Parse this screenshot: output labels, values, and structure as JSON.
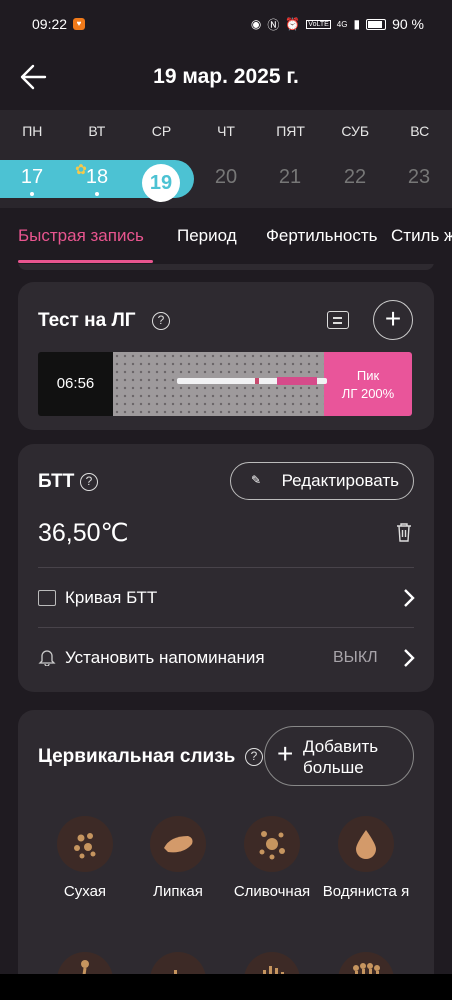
{
  "status_bar": {
    "time": "09:22",
    "battery": "90 %",
    "network": "4G",
    "volte": "VoLTE"
  },
  "header": {
    "title": "19 мар. 2025 г."
  },
  "calendar": {
    "weekdays": [
      "ПН",
      "ВТ",
      "СР",
      "ЧТ",
      "ПЯТ",
      "СУБ",
      "ВС"
    ],
    "dates": [
      "17",
      "18",
      "19",
      "20",
      "21",
      "22",
      "23"
    ],
    "today": "19"
  },
  "tabs": [
    "Быстрая запись",
    "Период",
    "Фертильность",
    "Стиль ж"
  ],
  "lh_test": {
    "title": "Тест на ЛГ",
    "time": "06:56",
    "result_line1": "Пик",
    "result_line2": "ЛГ 200%",
    "accent": "#e9559a"
  },
  "btt": {
    "title": "БТТ",
    "edit_label": "Редактировать",
    "value": "36,50℃",
    "curve_label": "Кривая БТТ",
    "reminder_label": "Установить напоминания",
    "reminder_state": "ВЫКЛ"
  },
  "cervical_mucus": {
    "title": "Цервикальная слизь",
    "add_more_line1": "Добавить",
    "add_more_line2": "больше",
    "options": [
      "Сухая",
      "Липкая",
      "Сливочная",
      "Водяниста я"
    ]
  },
  "colors": {
    "accent_pink": "#e9558f",
    "period_blue": "#4cc2d3",
    "card_bg": "#2e2a30"
  }
}
